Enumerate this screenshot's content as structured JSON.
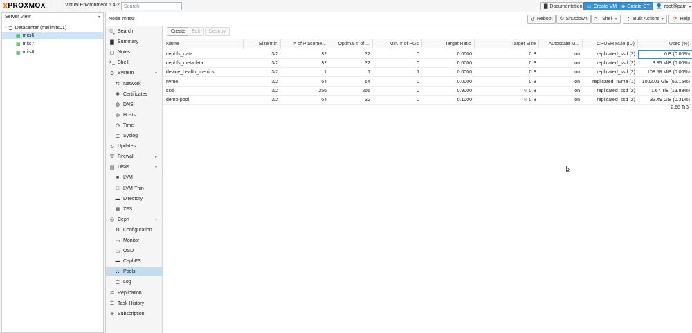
{
  "header": {
    "logo_x": "X",
    "logo_word": "PROXMOX",
    "product": "Virtual Environment 6.4-2",
    "search_placeholder": "Search",
    "documentation": "Documentation",
    "create_vm": "Create VM",
    "create_ct": "Create CT",
    "user": "root@pam"
  },
  "tree": {
    "view": "Server View",
    "datacenter": "Datacenter (mellmits01)",
    "nodes": [
      "mits6",
      "mits7",
      "mits8"
    ],
    "selected": "mits6"
  },
  "content": {
    "title": "Node 'mits6'",
    "buttons": {
      "reboot": "Reboot",
      "shutdown": "Shutdown",
      "shell": "Shell",
      "bulk": "Bulk Actions",
      "help": "Help"
    }
  },
  "nav": [
    {
      "label": "Search",
      "icon": "search-icon",
      "glyph": "🔍"
    },
    {
      "label": "Summary",
      "icon": "book-icon",
      "glyph": "▇"
    },
    {
      "label": "Notes",
      "icon": "note-icon",
      "glyph": "▢"
    },
    {
      "label": "Shell",
      "icon": "terminal-icon",
      "glyph": ">_"
    },
    {
      "label": "System",
      "icon": "cogs-icon",
      "glyph": "⚙",
      "arrow": "▾"
    },
    {
      "label": "Network",
      "icon": "exchange-icon",
      "glyph": "⇆"
    },
    {
      "label": "Certificates",
      "icon": "certificate-icon",
      "glyph": "✺"
    },
    {
      "label": "DNS",
      "icon": "globe-icon",
      "glyph": "◍"
    },
    {
      "label": "Hosts",
      "icon": "globe-icon",
      "glyph": "◍"
    },
    {
      "label": "Time",
      "icon": "clock-icon",
      "glyph": "◷"
    },
    {
      "label": "Syslog",
      "icon": "list-icon",
      "glyph": "☰"
    },
    {
      "label": "Updates",
      "icon": "refresh-icon",
      "glyph": "↻"
    },
    {
      "label": "Firewall",
      "icon": "shield-icon",
      "glyph": "⛨",
      "arrow": "▸"
    },
    {
      "label": "Disks",
      "icon": "hdd-icon",
      "glyph": "▤",
      "arrow": "▾"
    },
    {
      "label": "LVM",
      "icon": "square-icon",
      "glyph": "■"
    },
    {
      "label": "LVM-Thin",
      "icon": "square-outline-icon",
      "glyph": "□"
    },
    {
      "label": "Directory",
      "icon": "folder-icon",
      "glyph": "▬"
    },
    {
      "label": "ZFS",
      "icon": "grid-icon",
      "glyph": "▦"
    },
    {
      "label": "Ceph",
      "icon": "ceph-icon",
      "glyph": "◎",
      "arrow": "▾"
    },
    {
      "label": "Configuration",
      "icon": "gear-icon",
      "glyph": "⚙"
    },
    {
      "label": "Monitor",
      "icon": "desktop-icon",
      "glyph": "▭"
    },
    {
      "label": "OSD",
      "icon": "hdd-icon",
      "glyph": "▭"
    },
    {
      "label": "CephFS",
      "icon": "folder-icon",
      "glyph": "▬"
    },
    {
      "label": "Pools",
      "icon": "sitemap-icon",
      "glyph": "⛬"
    },
    {
      "label": "Log",
      "icon": "list-icon",
      "glyph": "☰"
    },
    {
      "label": "Replication",
      "icon": "retweet-icon",
      "glyph": "⇄"
    },
    {
      "label": "Task History",
      "icon": "list-icon",
      "glyph": "☰"
    },
    {
      "label": "Subscription",
      "icon": "support-icon",
      "glyph": "⊕"
    }
  ],
  "grid": {
    "buttons": {
      "create": "Create",
      "edit": "Edit",
      "destroy": "Destroy"
    },
    "headers": [
      "Name",
      "Size/min",
      "# of Placeme...",
      "Optimal # of ...",
      "Min. # of PGs",
      "Target Ratio",
      "Target Size",
      "Autoscale M...",
      "CRUSH Rule (ID)",
      "Used (%)"
    ],
    "rows": [
      {
        "name": "cephfs_data",
        "size": "3/2",
        "pgs": "32",
        "optimal": "32",
        "min_pgs": "0",
        "ratio": "0.0000",
        "tsize": "0 B",
        "tsize_icon": false,
        "autoscale": "on",
        "crush": "replicated_ssd (2)",
        "used": "0 B (0.00%)"
      },
      {
        "name": "cephfs_metadata",
        "size": "3/2",
        "pgs": "32",
        "optimal": "32",
        "min_pgs": "0",
        "ratio": "0.0000",
        "tsize": "0 B",
        "tsize_icon": false,
        "autoscale": "on",
        "crush": "replicated_ssd (2)",
        "used": "3.35 MiB (0.00%)"
      },
      {
        "name": "device_health_metrics",
        "size": "3/2",
        "pgs": "1",
        "optimal": "1",
        "min_pgs": "1",
        "ratio": "0.0000",
        "tsize": "0 B",
        "tsize_icon": false,
        "autoscale": "on",
        "crush": "replicated_ssd (2)",
        "used": "108.58 MiB (0.00%)"
      },
      {
        "name": "nvme",
        "size": "3/2",
        "pgs": "64",
        "optimal": "64",
        "min_pgs": "0",
        "ratio": "0.0000",
        "tsize": "0 B",
        "tsize_icon": false,
        "autoscale": "on",
        "crush": "replicated_nvme (1)",
        "used": "1002.01 GiB (52.15%)"
      },
      {
        "name": "ssd",
        "size": "3/2",
        "pgs": "256",
        "optimal": "256",
        "min_pgs": "0",
        "ratio": "0.9000",
        "tsize": "0 B",
        "tsize_icon": true,
        "autoscale": "on",
        "crush": "replicated_ssd (2)",
        "used": "1.67 TiB (13.83%)"
      },
      {
        "name": "demo-pool",
        "size": "3/2",
        "pgs": "64",
        "optimal": "32",
        "min_pgs": "0",
        "ratio": "0.1000",
        "tsize": "0 B",
        "tsize_icon": true,
        "autoscale": "on",
        "crush": "replicated_ssd (2)",
        "used": "33.49 GiB (0.31%)"
      }
    ],
    "total_used": "2.68 TiB"
  }
}
